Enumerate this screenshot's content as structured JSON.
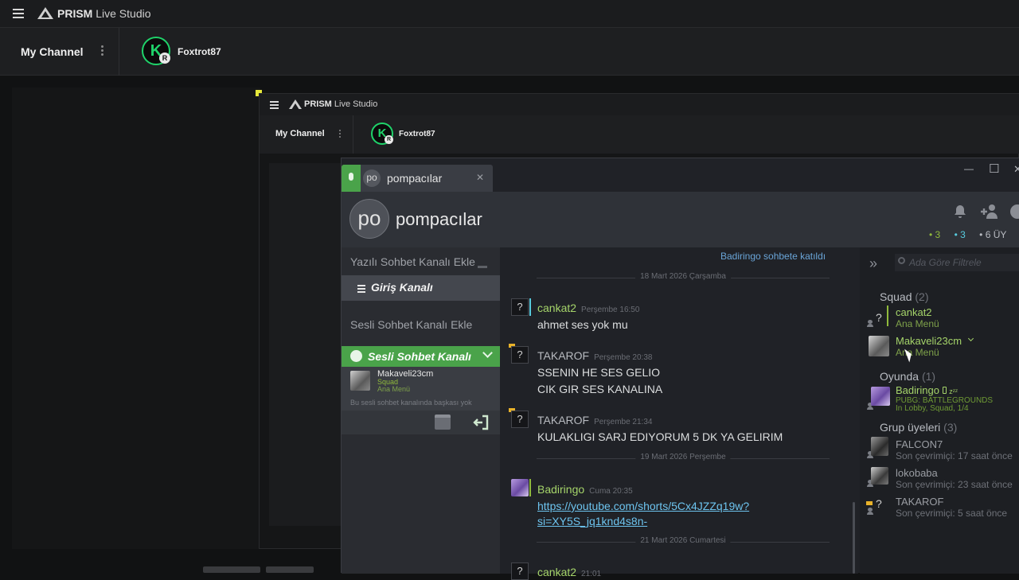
{
  "outer": {
    "app_name_bold": "PRISM",
    "app_name_light": "Live Studio",
    "channel_label": "My Channel",
    "account_name": "Foxtrot87",
    "avatar_letter": "K",
    "avatar_badge": "R"
  },
  "inner": {
    "app_name_bold": "PRISM",
    "app_name_light": "Live Studio",
    "channel_label": "My Channel",
    "account_name": "Foxtrot87",
    "avatar_letter": "K",
    "avatar_badge": "R"
  },
  "steam": {
    "tab": {
      "initials": "po",
      "title": "pompacılar",
      "close": "✕"
    },
    "window_controls": {
      "minimize": "—",
      "maximize": "☐",
      "close": "✕"
    },
    "group": {
      "initials": "po",
      "name": "pompacılar"
    },
    "counts": {
      "online_in_game": "3",
      "online": "3",
      "members": "6 ÜY"
    },
    "left_panel": {
      "add_text_channel": "Yazılı Sohbet Kanalı Ekle",
      "text_channel": "Giriş Kanalı",
      "add_voice_channel": "Sesli Sohbet Kanalı Ekle",
      "voice_channel": "Sesli Sohbet Kanalı",
      "voice_user": {
        "name": "Makaveli23cm",
        "group": "Squad",
        "status": "Ana Menü"
      },
      "voice_note": "Bu sesli sohbet kanalında başkası yok"
    },
    "chat": {
      "join_notice": "Badiringo sohbete katıldı",
      "date_1": "18 Mart 2026 Çarşamba",
      "messages": [
        {
          "user": "cankat2",
          "time": "Perşembe 16:50",
          "lines": [
            "ahmet ses yok mu"
          ]
        },
        {
          "user": "TAKAROF",
          "time": "Perşembe 20:38",
          "lines": [
            "SSENIN HE SES GELIO",
            "CIK GIR SES KANALINA"
          ]
        },
        {
          "user": "TAKAROF",
          "time": "Perşembe 21:34",
          "lines": [
            "KULAKLIGI SARJ EDIYORUM 5 DK YA GELIRIM"
          ]
        },
        {
          "user": "Badiringo",
          "time": "Cuma 20:35",
          "lines": [
            "https://youtube.com/shorts/5Cx4JZZq19w?",
            "si=XY5S_jq1knd4s8n-"
          ]
        },
        {
          "user": "cankat2",
          "time": "21:01",
          "lines": []
        }
      ],
      "date_2": "19 Mart 2026 Perşembe",
      "date_3": "21 Mart 2026 Cumartesi"
    },
    "right_panel": {
      "filter_placeholder": "Ada Göre Filtrele",
      "sections": [
        {
          "title": "Squad",
          "count": "(2)"
        },
        {
          "title": "Oyunda",
          "count": "(1)"
        },
        {
          "title": "Grup üyeleri",
          "count": "(3)"
        }
      ],
      "members": [
        {
          "name": "cankat2",
          "status": "Ana Menü"
        },
        {
          "name": "Makaveli23cm",
          "status": "Ana Menü"
        },
        {
          "name": "Badiringo",
          "status": "PUBG: BATTLEGROUNDS",
          "status2": "In Lobby, Squad, 1/4",
          "zz": "zᶻᶻ"
        },
        {
          "name": "FALCON7",
          "status": "Son çevrimiçi: 17 saat önce"
        },
        {
          "name": "lokobaba",
          "status": "Son çevrimiçi: 23 saat önce"
        },
        {
          "name": "TAKAROF",
          "status": "Son çevrimiçi: 5 saat önce"
        }
      ]
    }
  },
  "colors": {
    "accent_green": "#1fd36a",
    "ingame_green": "#90ba3c",
    "online_blue": "#57cbde",
    "link": "#6dc4ef"
  }
}
